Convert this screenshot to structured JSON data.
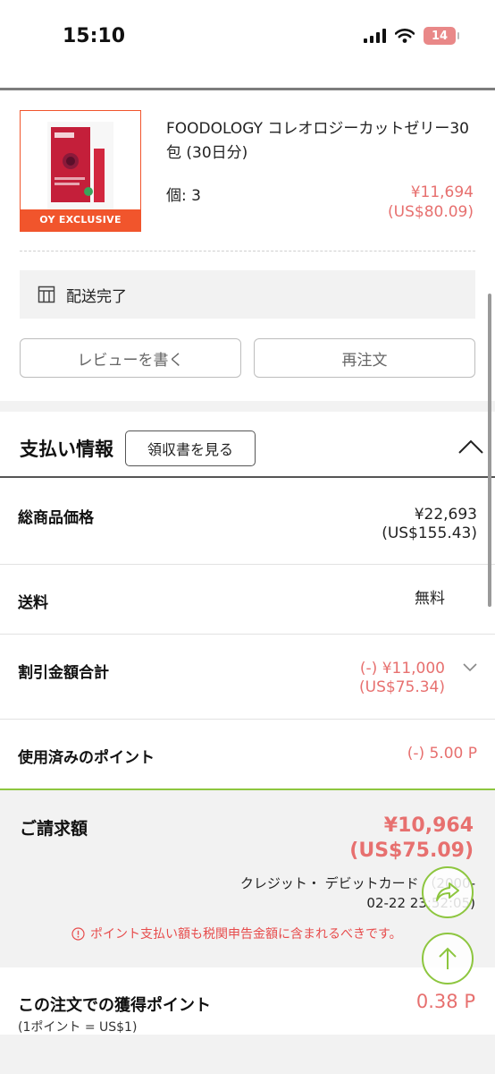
{
  "status_bar": {
    "time": "15:10",
    "battery": "14"
  },
  "order_item": {
    "name": "FOODOLOGY コレオロジーカットゼリー30包 (30日分)",
    "badge": "OY EXCLUSIVE",
    "quantity": "個: 3",
    "price_jpy": "¥11,694",
    "price_usd": "(US$80.09)"
  },
  "delivery": {
    "status": "配送完了"
  },
  "actions": {
    "review_label": "レビューを書く",
    "reorder_label": "再注文"
  },
  "payment": {
    "title": "支払い情報",
    "receipt_label": "領収書を見る",
    "rows": {
      "total": {
        "label": "総商品価格",
        "value_jpy": "¥22,693",
        "value_usd": "(US$155.43)"
      },
      "shipping": {
        "label": "送料",
        "value": "無料"
      },
      "discount": {
        "label": "割引金額合計",
        "value_jpy": "(-) ¥11,000",
        "value_usd": "(US$75.34)"
      },
      "points": {
        "label": "使用済みのポイント",
        "value": "(-) 5.00 P"
      }
    },
    "billing": {
      "label": "ご請求額",
      "amount_jpy": "¥10,964",
      "amount_usd": "(US$75.09)",
      "method_line1": "クレジット・ デビットカード （2000-",
      "method_line2": "02-22 23:52:05)",
      "notice": "ポイント支払い額も税関申告金額に含まれるべきです。"
    },
    "earned": {
      "label": "この注文での獲得ポイント",
      "sub": "(1ポイント = US$1)",
      "value": "0.38 P"
    }
  },
  "colors": {
    "accent_red": "#e7706f",
    "brand_orange": "#f1552c",
    "accent_green": "#8dc63f"
  }
}
